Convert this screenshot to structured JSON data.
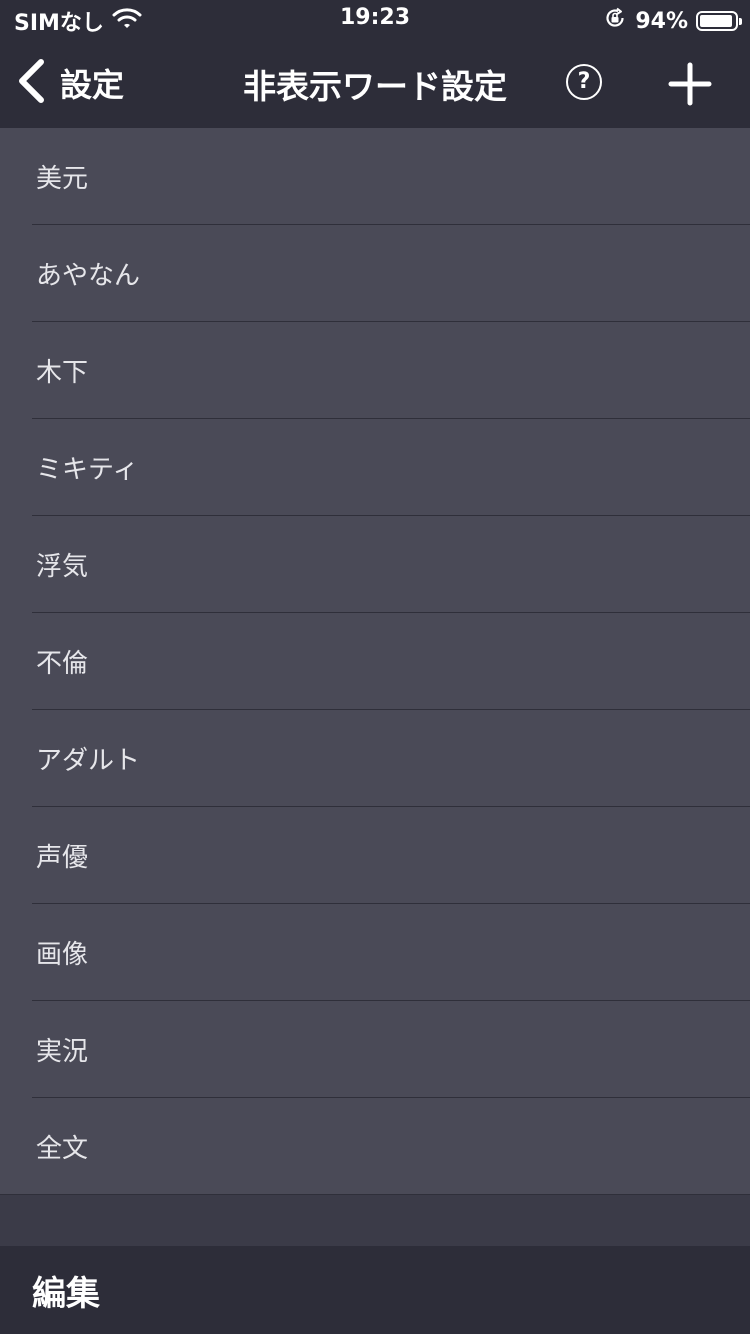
{
  "status_bar": {
    "carrier": "SIMなし",
    "time": "19:23",
    "battery": "94%",
    "battery_level": 0.94,
    "icons": [
      "wifi-icon",
      "orientation-lock-icon",
      "battery-icon"
    ]
  },
  "nav": {
    "back_label": "設定",
    "title": "非表示ワード設定",
    "help_label": "?",
    "icons": [
      "chevron-left-icon",
      "help-circle-icon",
      "plus-icon"
    ]
  },
  "words": [
    {
      "label": "美元"
    },
    {
      "label": "あやなん"
    },
    {
      "label": "木下"
    },
    {
      "label": "ミキティ"
    },
    {
      "label": "浮気"
    },
    {
      "label": "不倫"
    },
    {
      "label": "アダルト"
    },
    {
      "label": "声優"
    },
    {
      "label": "画像"
    },
    {
      "label": "実況"
    },
    {
      "label": "全文"
    }
  ],
  "toolbar": {
    "edit_label": "編集"
  },
  "colors": {
    "bar_background": "#2d2d39",
    "list_background": "#4a4a57",
    "page_background": "#3b3b48",
    "separator": "#2f2f3a",
    "text": "#e6e6ea"
  }
}
